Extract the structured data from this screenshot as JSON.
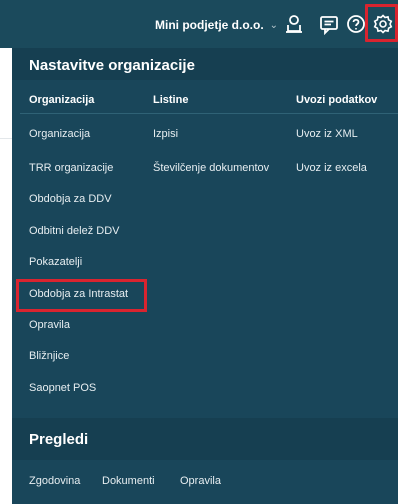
{
  "topbar": {
    "org_name": "Mini podjetje d.o.o.",
    "org_chevron": "⌄",
    "icons": [
      "user-icon",
      "message-icon",
      "help-icon",
      "gear-icon"
    ],
    "highlight_color": "#d9242f",
    "background": "#1b4a5c"
  },
  "settings_panel": {
    "title": "Nastavitve organizacije",
    "columns": [
      {
        "header": "Organizacija",
        "items": [
          "Organizacija",
          "TRR organizacije",
          "Obdobja za DDV",
          "Odbitni delež DDV",
          "Pokazatelji",
          "Obdobja za Intrastat",
          "Opravila",
          "Bližnjice",
          "Saopnet POS"
        ]
      },
      {
        "header": "Listine",
        "items": [
          "Izpisi",
          "Številčenje dokumentov"
        ]
      },
      {
        "header": "Uvozi podatkov",
        "items": [
          "Uvoz iz XML",
          "Uvoz iz excela"
        ]
      }
    ],
    "highlighted_item": "Obdobja za Intrastat"
  },
  "reviews": {
    "title": "Pregledi",
    "items": [
      "Zgodovina",
      "Dokumenti",
      "Opravila"
    ]
  }
}
